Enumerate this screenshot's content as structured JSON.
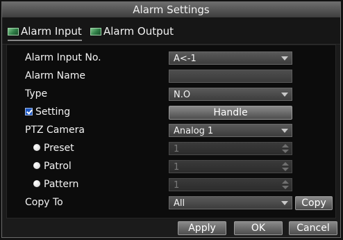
{
  "window": {
    "title": "Alarm Settings"
  },
  "tabs": [
    {
      "label": "Alarm Input",
      "icon": "alarm-input-tab-icon"
    },
    {
      "label": "Alarm Output",
      "icon": "alarm-output-tab-icon"
    }
  ],
  "form": {
    "alarm_input_no": {
      "label": "Alarm Input No.",
      "value": "A<-1"
    },
    "alarm_name": {
      "label": "Alarm Name",
      "value": ""
    },
    "type": {
      "label": "Type",
      "value": "N.O"
    },
    "setting": {
      "label": "Setting",
      "checked": true,
      "button_label": "Handle"
    },
    "ptz_camera": {
      "label": "PTZ Camera",
      "value": "Analog 1"
    },
    "preset": {
      "label": "Preset",
      "value": "1"
    },
    "patrol": {
      "label": "Patrol",
      "value": "1"
    },
    "pattern": {
      "label": "Pattern",
      "value": "1"
    },
    "copy_to": {
      "label": "Copy To",
      "value": "All",
      "button_label": "Copy"
    }
  },
  "actions": {
    "apply": "Apply",
    "ok": "OK",
    "cancel": "Cancel"
  },
  "colors": {
    "checkbox": "#1d58c4",
    "tab_icon": "#3f9c5a"
  }
}
